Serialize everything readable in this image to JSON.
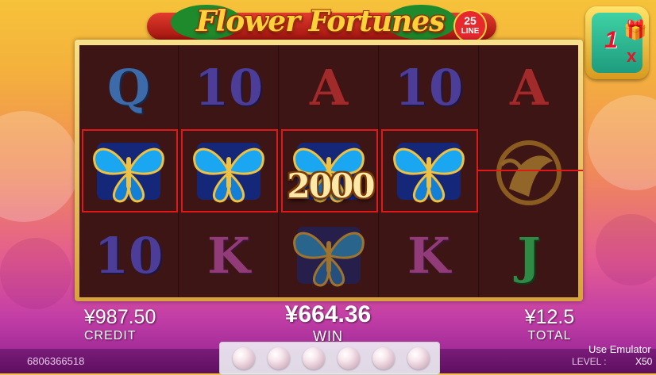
{
  "title": {
    "name": "Flower Fortunes",
    "lines_number": "25",
    "lines_word": "LINE"
  },
  "reels": [
    [
      "Q",
      "butterfly",
      "10"
    ],
    [
      "10",
      "butterfly",
      "K"
    ],
    [
      "A",
      "butterfly",
      "butterfly"
    ],
    [
      "10",
      "butterfly",
      "K"
    ],
    [
      "A",
      "phoenix",
      "J"
    ]
  ],
  "win_overlay": "2000",
  "gift": {
    "count": "1",
    "multiplier": "x",
    "icon": "gift-icon"
  },
  "stats": {
    "credit_value": "¥987.50",
    "credit_label": "CREDIT",
    "win_value": "¥664.36",
    "win_label": "WIN",
    "total_value": "¥12.5",
    "total_label": "TOTAL"
  },
  "footer": {
    "account_id": "6806366518",
    "emulator_note": "Use Emulator",
    "level_label": "LEVEL :",
    "level_value": "X50",
    "pearl_count": 6
  },
  "colors": {
    "payline": "#e01818",
    "title_gold": "#ffd23a",
    "frame_gold": "#d8a23c"
  }
}
